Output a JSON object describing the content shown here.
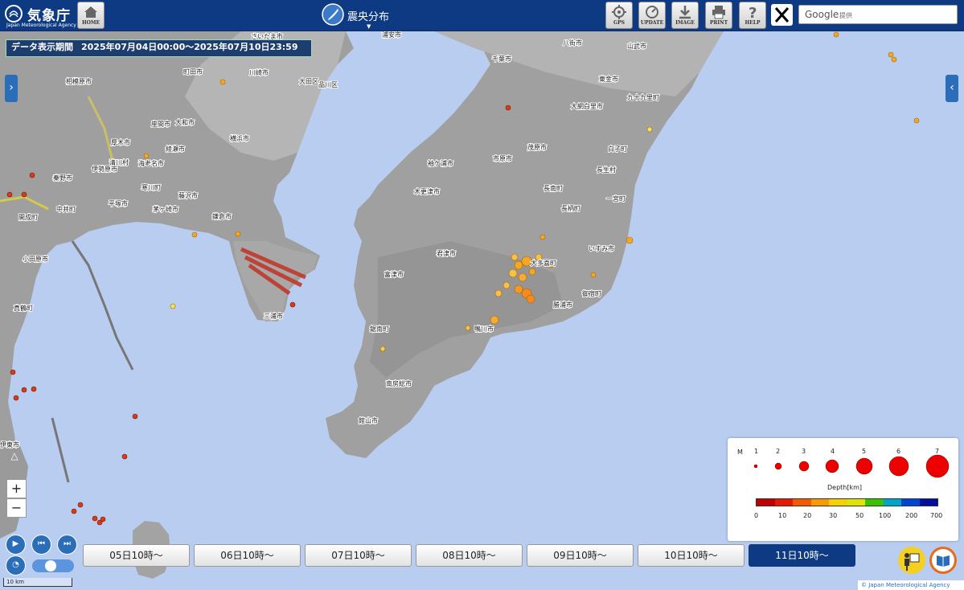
{
  "app": {
    "logo_name": "気象庁",
    "logo_en": "Japan Meteorological Agency",
    "title": "震央分布"
  },
  "toolbar": {
    "home": "HOME",
    "gps": "GPS",
    "update": "UPDATE",
    "image": "IMAGE",
    "print": "PRINT",
    "help": "HELP"
  },
  "search": {
    "brand": "Google",
    "provided": "提供"
  },
  "period": {
    "label": "データ表示期間",
    "range": "2025年07月04日00:00～2025年07月10日23:59"
  },
  "zoom": {
    "in": "+",
    "out": "−"
  },
  "place_names": [
    "さいたま市",
    "浦安市",
    "町田市",
    "川崎市",
    "大田区",
    "相模原市",
    "横浜市",
    "座間市",
    "大和市",
    "綾瀬市",
    "海老名市",
    "厚木市",
    "伊勢原市",
    "秦野市",
    "平塚市",
    "藤沢市",
    "茅ヶ崎市",
    "寒川町",
    "鎌倉市",
    "中井町",
    "開成町",
    "小田原市",
    "真鶴町",
    "三浦市",
    "千葉市",
    "東金市",
    "大網白里市",
    "九十九里町",
    "山武市",
    "八街市",
    "袖ケ浦市",
    "市原市",
    "茂原市",
    "白子町",
    "長生村",
    "長南町",
    "木更津市",
    "君津市",
    "富津市",
    "いすみ市",
    "大多喜町",
    "勝浦市",
    "御宿町",
    "鋸南町",
    "鴨川市",
    "南房総市",
    "館山市",
    "一宮町",
    "長柄町",
    "伊東市",
    "品川区",
    "清川村"
  ],
  "legend": {
    "m_label": "M",
    "magnitudes": [
      "1",
      "2",
      "3",
      "4",
      "5",
      "6",
      "7"
    ],
    "depth_label": "Depth[km]",
    "depth_ticks": [
      "0",
      "10",
      "20",
      "30",
      "50",
      "100",
      "200",
      "700"
    ],
    "depth_colors": [
      "#c20000",
      "#e61a00",
      "#f55a00",
      "#fa9a00",
      "#f7d000",
      "#dde500",
      "#38c200",
      "#00a6c9",
      "#0044d6",
      "#000fa0"
    ]
  },
  "timeline": {
    "days": [
      "05日10時～",
      "06日10時～",
      "07日10時～",
      "08日10時～",
      "09日10時～",
      "10日10時～",
      "11日10時～"
    ],
    "active_index": 6
  },
  "scale": "10 km",
  "copyright": "© Japan Meteorological Agency",
  "colors": {
    "header": "#0d3a82",
    "sea": "#b9cdf0",
    "land": "#9c9c9c",
    "accent": "#2a6db8"
  }
}
